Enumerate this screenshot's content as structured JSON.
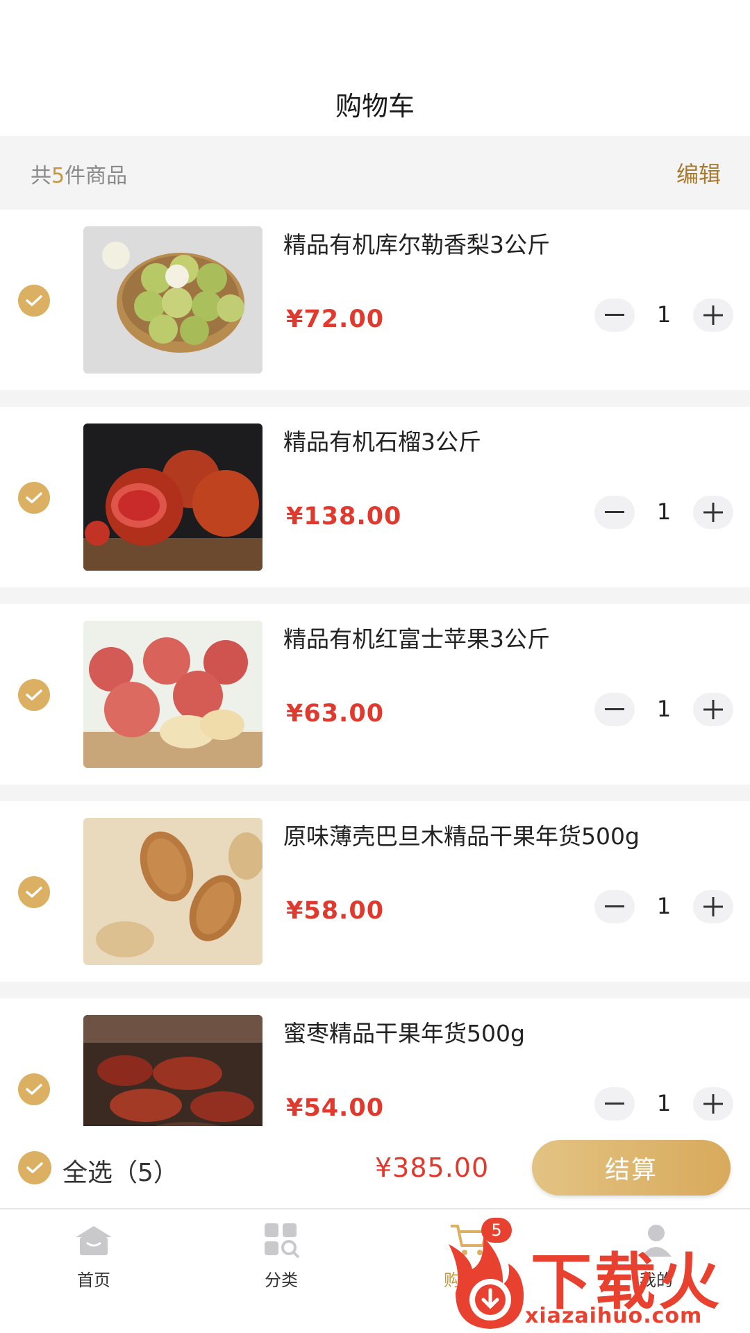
{
  "header": {
    "title": "购物车"
  },
  "summary": {
    "prefix": "共",
    "count": "5",
    "suffix": "件商品",
    "edit_label": "编辑"
  },
  "items": [
    {
      "title": "精品有机库尔勒香梨3公斤",
      "price": "¥72.00",
      "qty": "1",
      "image": "pears"
    },
    {
      "title": "精品有机石榴3公斤",
      "price": "¥138.00",
      "qty": "1",
      "image": "pomegranates"
    },
    {
      "title": "精品有机红富士苹果3公斤",
      "price": "¥63.00",
      "qty": "1",
      "image": "apples"
    },
    {
      "title": "原味薄壳巴旦木精品干果年货500g",
      "price": "¥58.00",
      "qty": "1",
      "image": "almonds"
    },
    {
      "title": "蜜枣精品干果年货500g",
      "price": "¥54.00",
      "qty": "1",
      "image": "dates"
    }
  ],
  "bottom_bar": {
    "select_all_label": "全选（5）",
    "total": "¥385.00",
    "checkout_label": "结算"
  },
  "tabs": [
    {
      "label": "首页",
      "icon": "home-icon"
    },
    {
      "label": "分类",
      "icon": "category-icon"
    },
    {
      "label": "购物车",
      "icon": "cart-icon",
      "badge": "5",
      "active": true
    },
    {
      "label": "我的",
      "icon": "user-icon"
    }
  ],
  "watermark": {
    "text": "下载火",
    "url": "xiazaihuo.com"
  },
  "colors": {
    "accent": "#dbb062",
    "price": "#e03a2f",
    "badge": "#e8412f",
    "edit": "#a87b32"
  }
}
